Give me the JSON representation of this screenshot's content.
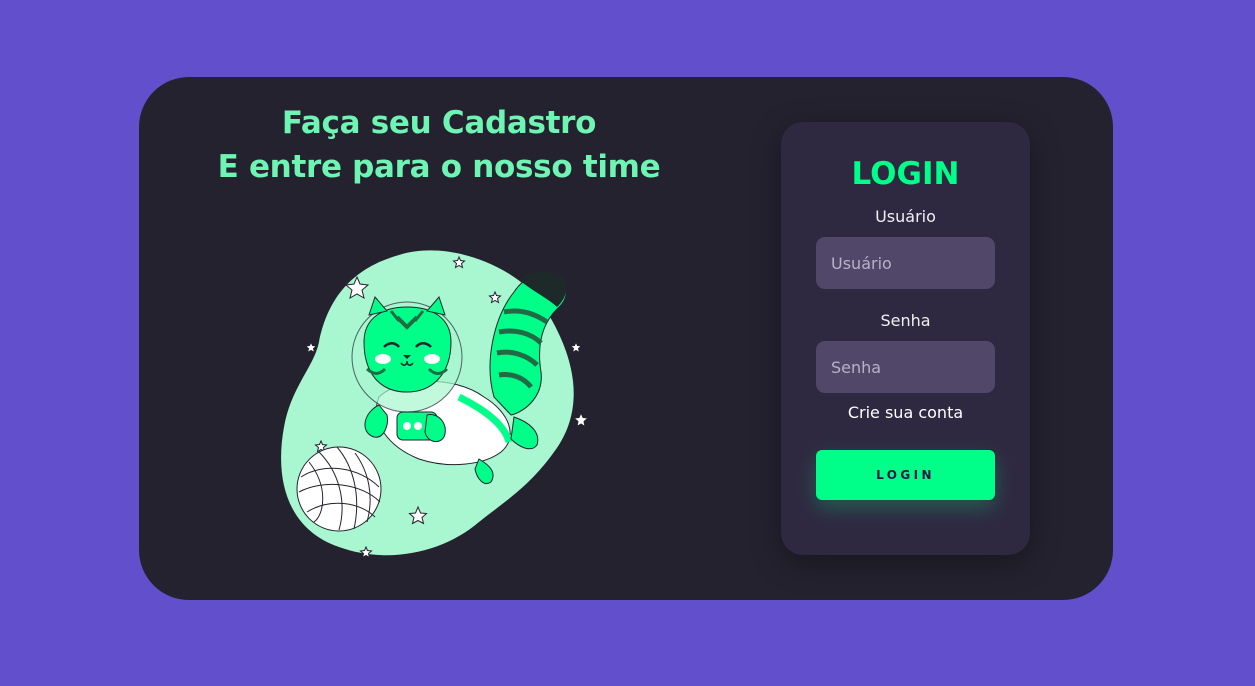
{
  "hero": {
    "line1": "Faça seu Cadastro",
    "line2": "E entre para o nosso time"
  },
  "illustration": {
    "icon": "astronaut-cat-illustration",
    "colors": {
      "blob": "#a8f7d0",
      "cat": "#00ff88",
      "stripes": "#1f6b46",
      "tail_tip": "#1e2a2a",
      "suit": "#ffffff"
    }
  },
  "login": {
    "title": "LOGIN",
    "username_label": "Usuário",
    "username_placeholder": "Usuário",
    "username_value": "",
    "password_label": "Senha",
    "password_placeholder": "Senha",
    "password_value": "",
    "signup_link": "Crie sua conta",
    "button_label": "LOGIN"
  },
  "colors": {
    "page_background": "#614fcb",
    "card_background": "#24222f",
    "panel_background": "#2f2841",
    "input_background": "#514869",
    "accent": "#00ff88",
    "headline": "#6ff5b3"
  }
}
